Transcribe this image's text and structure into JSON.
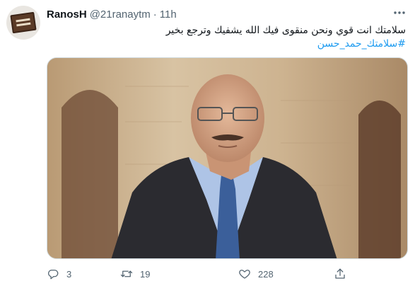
{
  "tweet": {
    "display_name": "RanosH",
    "handle": "@21ranaytm",
    "separator": "·",
    "time": "11h",
    "text": "سلامتك انت قوي ونحن منقوى فيك الله يشفيك وترجع بخير",
    "hashtag": "#سلامتك_حمد_حسن",
    "replies": "3",
    "retweets": "19",
    "likes": "228"
  },
  "icons": {
    "more": "more-icon",
    "reply": "reply-icon",
    "retweet": "retweet-icon",
    "like": "heart-icon",
    "share": "share-icon"
  },
  "colors": {
    "link": "#1d9bf0",
    "muted": "#536471",
    "text": "#0f1419"
  }
}
